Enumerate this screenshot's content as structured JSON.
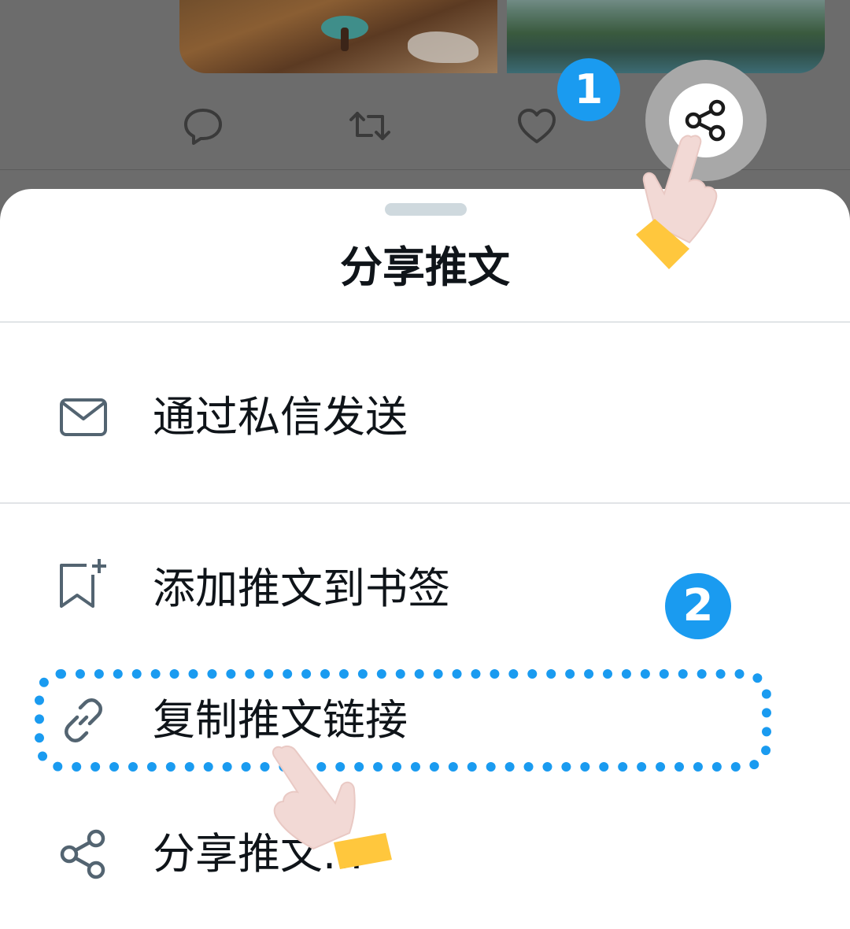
{
  "sheet": {
    "title": "分享推文",
    "items": [
      {
        "icon": "envelope-icon",
        "label": "通过私信发送"
      },
      {
        "icon": "bookmark-add-icon",
        "label": "添加推文到书签"
      },
      {
        "icon": "link-icon",
        "label": "复制推文链接"
      },
      {
        "icon": "share-icon",
        "label": "分享推文..."
      }
    ]
  },
  "steps": {
    "step1": "1",
    "step2": "2"
  },
  "tweet_actions": [
    "reply-icon",
    "retweet-icon",
    "like-icon",
    "share-icon"
  ],
  "colors": {
    "accent": "#1a9bf0",
    "icon_gray": "#536471",
    "text": "#0f1419",
    "hand_cuff": "#ffc73d",
    "hand_skin": "#f2d9d5"
  }
}
